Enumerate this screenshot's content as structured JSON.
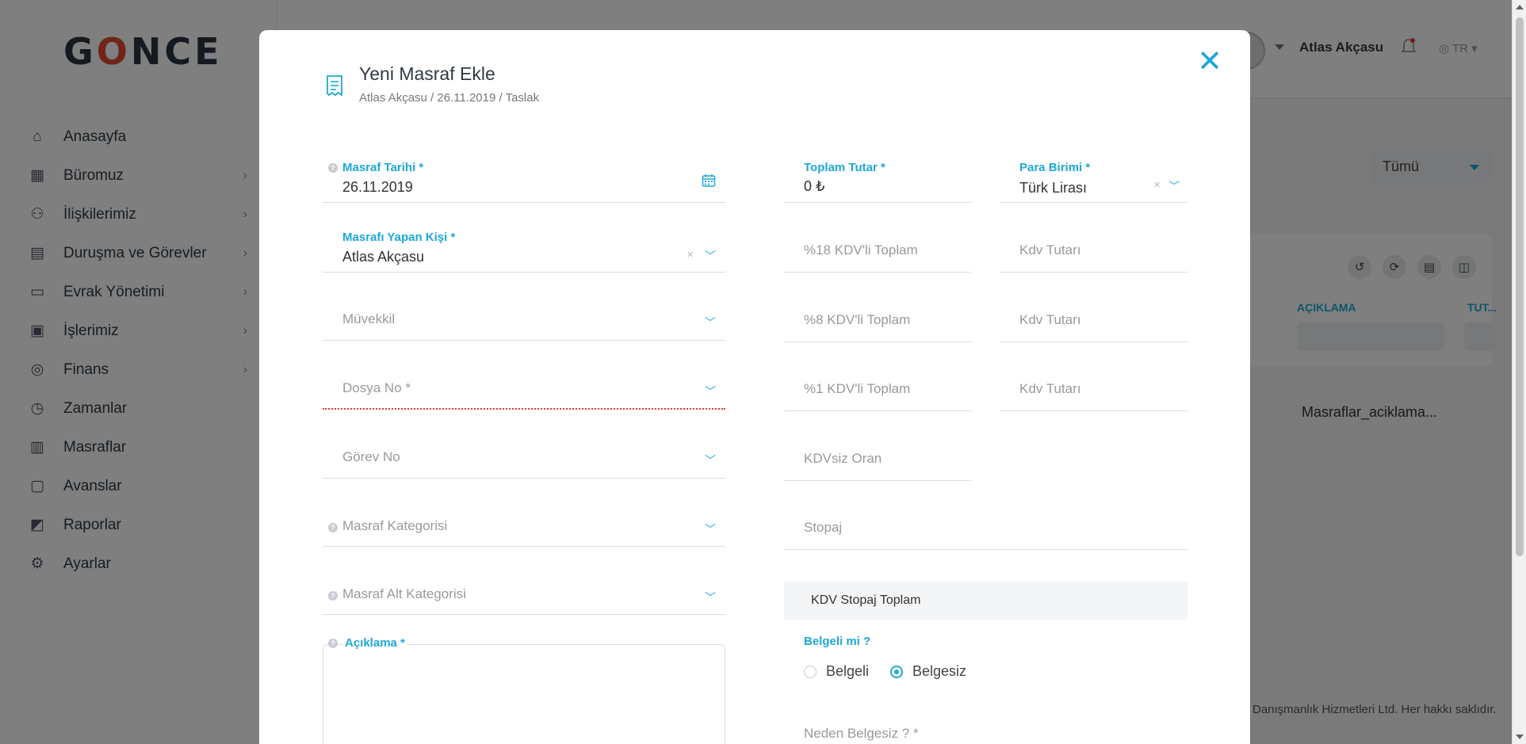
{
  "app": {
    "logo_text": "GONCE",
    "user_name": "Atlas Akçasu",
    "lang": "TR"
  },
  "sidebar": {
    "items": [
      {
        "label": "Anasayfa",
        "icon": "home-icon",
        "has_children": false
      },
      {
        "label": "Büromuz",
        "icon": "building-icon",
        "has_children": true
      },
      {
        "label": "İlişkilerimiz",
        "icon": "people-icon",
        "has_children": true
      },
      {
        "label": "Duruşma ve Görevler",
        "icon": "clipboard-icon",
        "has_children": true
      },
      {
        "label": "Evrak Yönetimi",
        "icon": "document-icon",
        "has_children": true
      },
      {
        "label": "İşlerimiz",
        "icon": "briefcase-icon",
        "has_children": true
      },
      {
        "label": "Finans",
        "icon": "coins-icon",
        "has_children": true
      },
      {
        "label": "Zamanlar",
        "icon": "clock-icon",
        "has_children": false
      },
      {
        "label": "Masraflar",
        "icon": "receipt-icon",
        "has_children": false
      },
      {
        "label": "Avanslar",
        "icon": "wallet-icon",
        "has_children": false
      },
      {
        "label": "Raporlar",
        "icon": "chart-icon",
        "has_children": false
      },
      {
        "label": "Ayarlar",
        "icon": "gear-icon",
        "has_children": false
      }
    ]
  },
  "background": {
    "filter_value": "Tümü",
    "column_headers": [
      "AÇIKLAMA",
      "TUT..."
    ],
    "row_text": "Masraflar_aciklama...",
    "footer": "Danışmanlık Hizmetleri Ltd. Her hakkı saklıdır."
  },
  "modal": {
    "title": "Yeni Masraf Ekle",
    "subtitle": "Atlas Akçasu / 26.11.2019 / Taslak",
    "close_symbol": "✕",
    "fields": {
      "masraf_tarihi": {
        "label": "Masraf Tarihi *",
        "value": "26.11.2019"
      },
      "masrafi_yapan": {
        "label": "Masrafı Yapan Kişi *",
        "value": "Atlas Akçasu"
      },
      "muvekkil": {
        "placeholder": "Müvekkil"
      },
      "dosya_no": {
        "placeholder": "Dosya No *"
      },
      "gorev_no": {
        "placeholder": "Görev No"
      },
      "masraf_kategorisi": {
        "placeholder": "Masraf Kategorisi"
      },
      "masraf_alt_kategorisi": {
        "placeholder": "Masraf Alt Kategorisi"
      },
      "aciklama": {
        "label": "Açıklama *"
      },
      "toplam_tutar": {
        "label": "Toplam Tutar *",
        "value": "0 ₺"
      },
      "para_birimi": {
        "label": "Para Birimi *",
        "value": "Türk Lirası"
      },
      "kdv18_toplam": {
        "placeholder": "%18 KDV'li Toplam"
      },
      "kdv18_tutar": {
        "placeholder": "Kdv Tutarı"
      },
      "kdv8_toplam": {
        "placeholder": "%8 KDV'li Toplam"
      },
      "kdv8_tutar": {
        "placeholder": "Kdv Tutarı"
      },
      "kdv1_toplam": {
        "placeholder": "%1 KDV'li Toplam"
      },
      "kdv1_tutar": {
        "placeholder": "Kdv Tutarı"
      },
      "kdvsiz_oran": {
        "placeholder": "KDVsiz Oran"
      },
      "stopaj": {
        "placeholder": "Stopaj"
      },
      "kdv_stopaj_toplam": {
        "label": "KDV Stopaj Toplam"
      },
      "belgeli_mi": {
        "label": "Belgeli mi ?",
        "options": [
          "Belgeli",
          "Belgesiz"
        ],
        "selected": "Belgesiz"
      },
      "neden_belgesiz": {
        "placeholder": "Neden Belgesiz ? *"
      }
    }
  },
  "colors": {
    "accent": "#1ea8d8",
    "error": "#e53935",
    "overlay": "rgba(0,0,0,0.5)"
  }
}
